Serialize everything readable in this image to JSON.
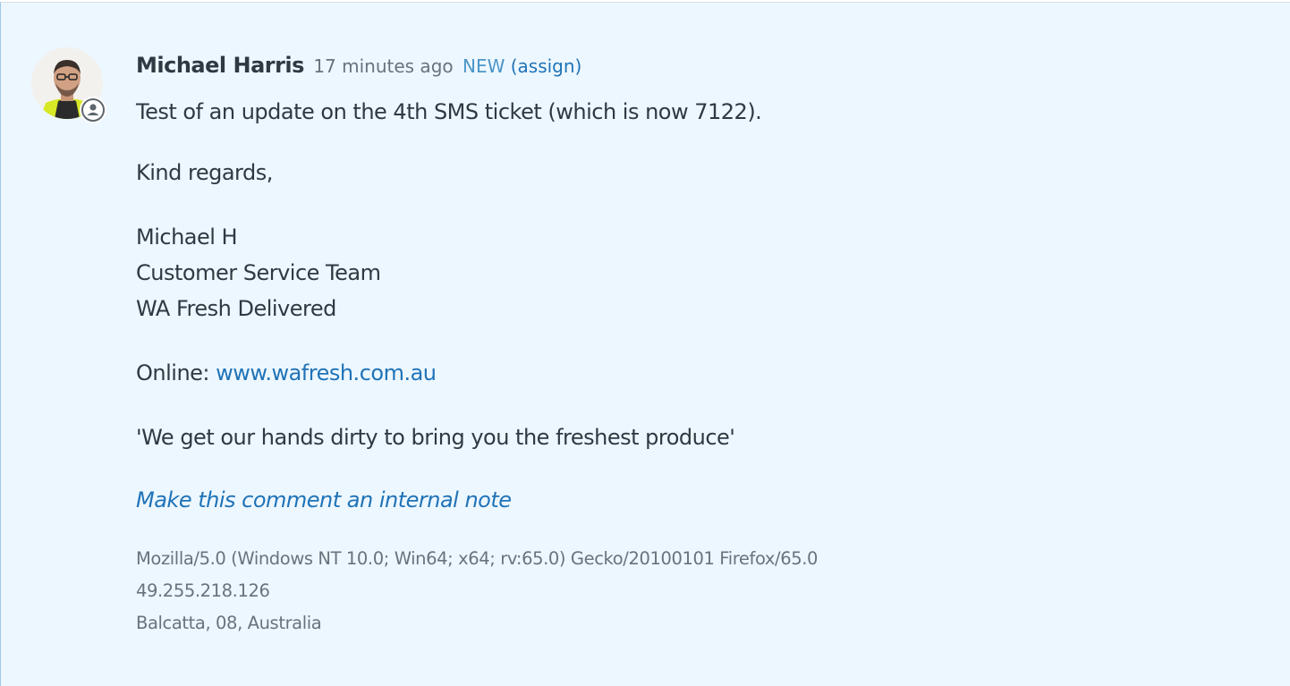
{
  "comment": {
    "author": "Michael Harris",
    "time": "17 minutes ago",
    "status": "NEW",
    "assign_label": "(assign)",
    "body": {
      "line1": "Test of an update on the 4th SMS ticket (which is now 7122).",
      "regards": "Kind regards,",
      "sig_name": "Michael H",
      "sig_team": "Customer Service Team",
      "sig_company": "WA Fresh Delivered",
      "online_label": "Online: ",
      "online_link": "www.wafresh.com.au",
      "tagline": "'We get our hands dirty to bring you the freshest produce'"
    },
    "internal_note_label": "Make this comment an internal note",
    "meta": {
      "user_agent": "Mozilla/5.0 (Windows NT 10.0; Win64; x64; rv:65.0) Gecko/20100101 Firefox/65.0",
      "ip": "49.255.218.126",
      "location": "Balcatta, 08, Australia"
    },
    "icons": {
      "avatar": "user-photo-avatar",
      "presence": "agent-person-icon"
    },
    "colors": {
      "background": "#edf7ff",
      "link": "#1f73b7",
      "status": "#4a95c8",
      "muted": "#68737d",
      "text": "#2f3941"
    }
  }
}
